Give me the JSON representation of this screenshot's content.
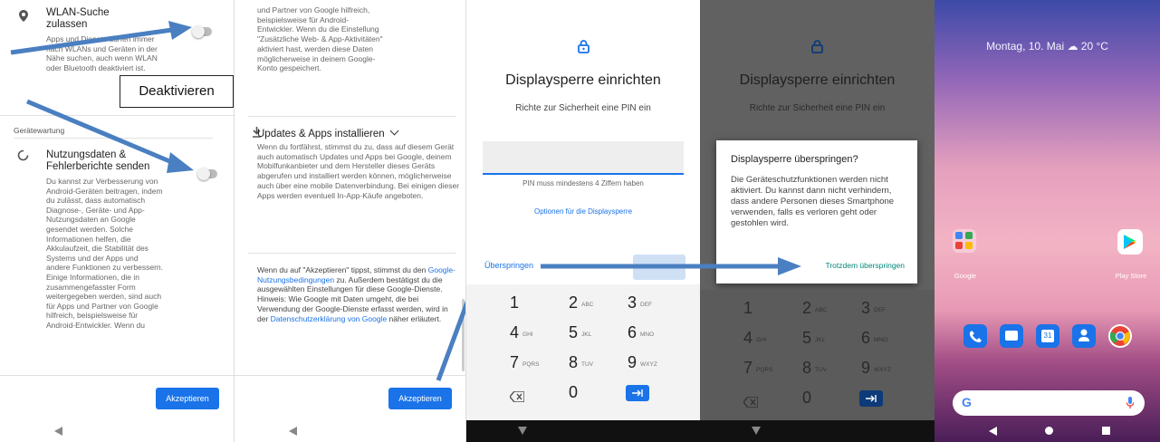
{
  "panel1": {
    "wlan_title": "WLAN-Suche zulassen",
    "wlan_desc": "Apps und Dienste dürfen immer nach WLANs und Geräten in der Nähe suchen, auch wenn WLAN oder Bluetooth deaktiviert ist.",
    "callout": "Deaktivieren",
    "section_label": "Gerätewartung",
    "usage_title": "Nutzungsdaten & Fehlerberichte senden",
    "usage_desc": "Du kannst zur Verbesserung von Android-Geräten beitragen, indem du zulässt, dass automatisch Diagnose-, Geräte- und App-Nutzungsdaten an Google gesendet werden. Solche Informationen helfen, die Akkulaufzeit, die Stabilität des Systems und der Apps und andere Funktionen zu verbessern. Einige Informationen, die in zusammengefasster Form weitergegeben werden, sind auch für Apps und Partner von Google hilfreich, beispielsweise für Android-Entwickler. Wenn du",
    "accept": "Akzeptieren"
  },
  "panel2": {
    "top_text": "und Partner von Google hilfreich, beispielsweise für Android-Entwickler. Wenn du die Einstellung \"Zusätzliche Web- & App-Aktivitäten\" aktiviert hast, werden diese Daten möglicherweise in deinem Google-Konto gespeichert.",
    "updates_title": "Updates & Apps installieren",
    "updates_desc": "Wenn du fortfährst, stimmst du zu, dass auf diesem Gerät auch automatisch Updates und Apps bei Google, deinem Mobilfunkanbieter und dem Hersteller dieses Geräts abgerufen und installiert werden können, möglicherweise auch über eine mobile Datenverbindung. Bei einigen dieser Apps werden eventuell In-App-Käufe angeboten.",
    "terms_pre": "Wenn du auf \"Akzeptieren\" tippst, stimmst du den ",
    "terms_link1": "Google-Nutzungsbedingungen",
    "terms_mid": " zu. Außerdem bestätigst du die ausgewählten Einstellungen für diese Google-Dienste. Hinweis: Wie Google mit Daten umgeht, die bei Verwendung der Google-Dienste erfasst werden, wird in der ",
    "terms_link2": "Datenschutzerklärung von Google",
    "terms_post": " näher erläutert.",
    "accept": "Akzeptieren"
  },
  "panel3": {
    "title": "Displaysperre einrichten",
    "subtitle": "Richte zur Sicherheit eine PIN ein",
    "hint": "PIN muss mindestens 4 Ziffern haben",
    "options": "Optionen für die Displaysperre",
    "skip": "Überspringen"
  },
  "panel4": {
    "title": "Displaysperre einrichten",
    "subtitle": "Richte zur Sicherheit eine PIN ein",
    "dialog_title": "Displaysperre überspringen?",
    "dialog_body": "Die Geräteschutzfunktionen werden nicht aktiviert. Du kannst dann nicht verhindern, dass andere Personen dieses Smartphone verwenden, falls es verloren geht oder gestohlen wird.",
    "dialog_action": "Trotzdem überspringen"
  },
  "keypad": [
    {
      "d": "1",
      "l": ""
    },
    {
      "d": "2",
      "l": "ABC"
    },
    {
      "d": "3",
      "l": "DEF"
    },
    {
      "d": "4",
      "l": "GHI"
    },
    {
      "d": "5",
      "l": "JKL"
    },
    {
      "d": "6",
      "l": "MNO"
    },
    {
      "d": "7",
      "l": "PQRS"
    },
    {
      "d": "8",
      "l": "TUV"
    },
    {
      "d": "9",
      "l": "WXYZ"
    },
    {
      "d": "",
      "l": ""
    },
    {
      "d": "0",
      "l": ""
    },
    {
      "d": "",
      "l": ""
    }
  ],
  "panel5": {
    "date_weather": "Montag, 10. Mai ☁ 20 °C",
    "folder_label": "Google",
    "play_label": "Play Store"
  },
  "colors": {
    "accent": "#1a73e8",
    "teal": "#00897b",
    "arrow": "#4a7fc1"
  }
}
